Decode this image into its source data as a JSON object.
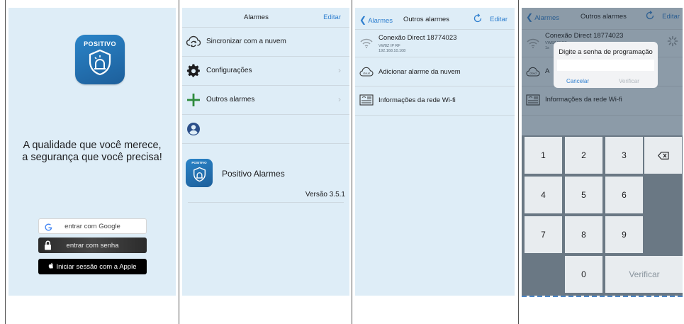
{
  "screen1": {
    "logo_text": "POSITIVO",
    "slogan_line1": "A qualidade que você merece,",
    "slogan_line2": "a segurança que você precisa!",
    "google_button": "entrar com Google",
    "google_icon": "google-g-icon",
    "password_button": "entrar com senha",
    "password_icon": "lock-icon",
    "apple_button": "Iniciar sessão com a Apple",
    "apple_icon": "apple-icon"
  },
  "screen2": {
    "title": "Alarmes",
    "edit": "Editar",
    "items": [
      {
        "label": "Sincronizar com a nuvem",
        "icon": "cloud-sync-icon"
      },
      {
        "label": "Configurações",
        "icon": "gear-icon"
      },
      {
        "label": "Outros alarmes",
        "icon": "plus-icon"
      },
      {
        "label": "",
        "icon": "user-icon"
      }
    ],
    "about_logo_text": "POSITIVO",
    "about_title": "Positivo Alarmes",
    "version": "Versão 3.5.1"
  },
  "screen3": {
    "back": "Alarmes",
    "title": "Outros alarmes",
    "edit": "Editar",
    "device_name": "Conexão Direct 18774023",
    "device_model": "VW8Z IP RF",
    "device_ip": "192.168.10.108",
    "add_cloud": "Adicionar alarme da nuvem",
    "wifi_info": "Informações da rede Wi-fi"
  },
  "screen4": {
    "back": "Alarmes",
    "title": "Outros alarmes",
    "edit": "Editar",
    "device_name": "Conexão Direct 18774023",
    "device_model": "VW8Z IP RF",
    "device_ip_partial": "1s",
    "add_cloud_partial": "A",
    "wifi_info": "Informações da rede Wi-fi",
    "dialog_title": "Digite a senha de programação",
    "cancel": "Cancelar",
    "verify": "Verificar",
    "keys": [
      "1",
      "2",
      "3",
      "4",
      "5",
      "6",
      "7",
      "8",
      "9",
      "0"
    ],
    "verify_key": "Verificar"
  },
  "colors": {
    "screen_bg": "#deedf7",
    "accent_blue": "#2f7fcf",
    "logo_blue": "#1d5f9b",
    "plus_green": "#2e8b3e",
    "keypad_bg": "#6a7884"
  }
}
